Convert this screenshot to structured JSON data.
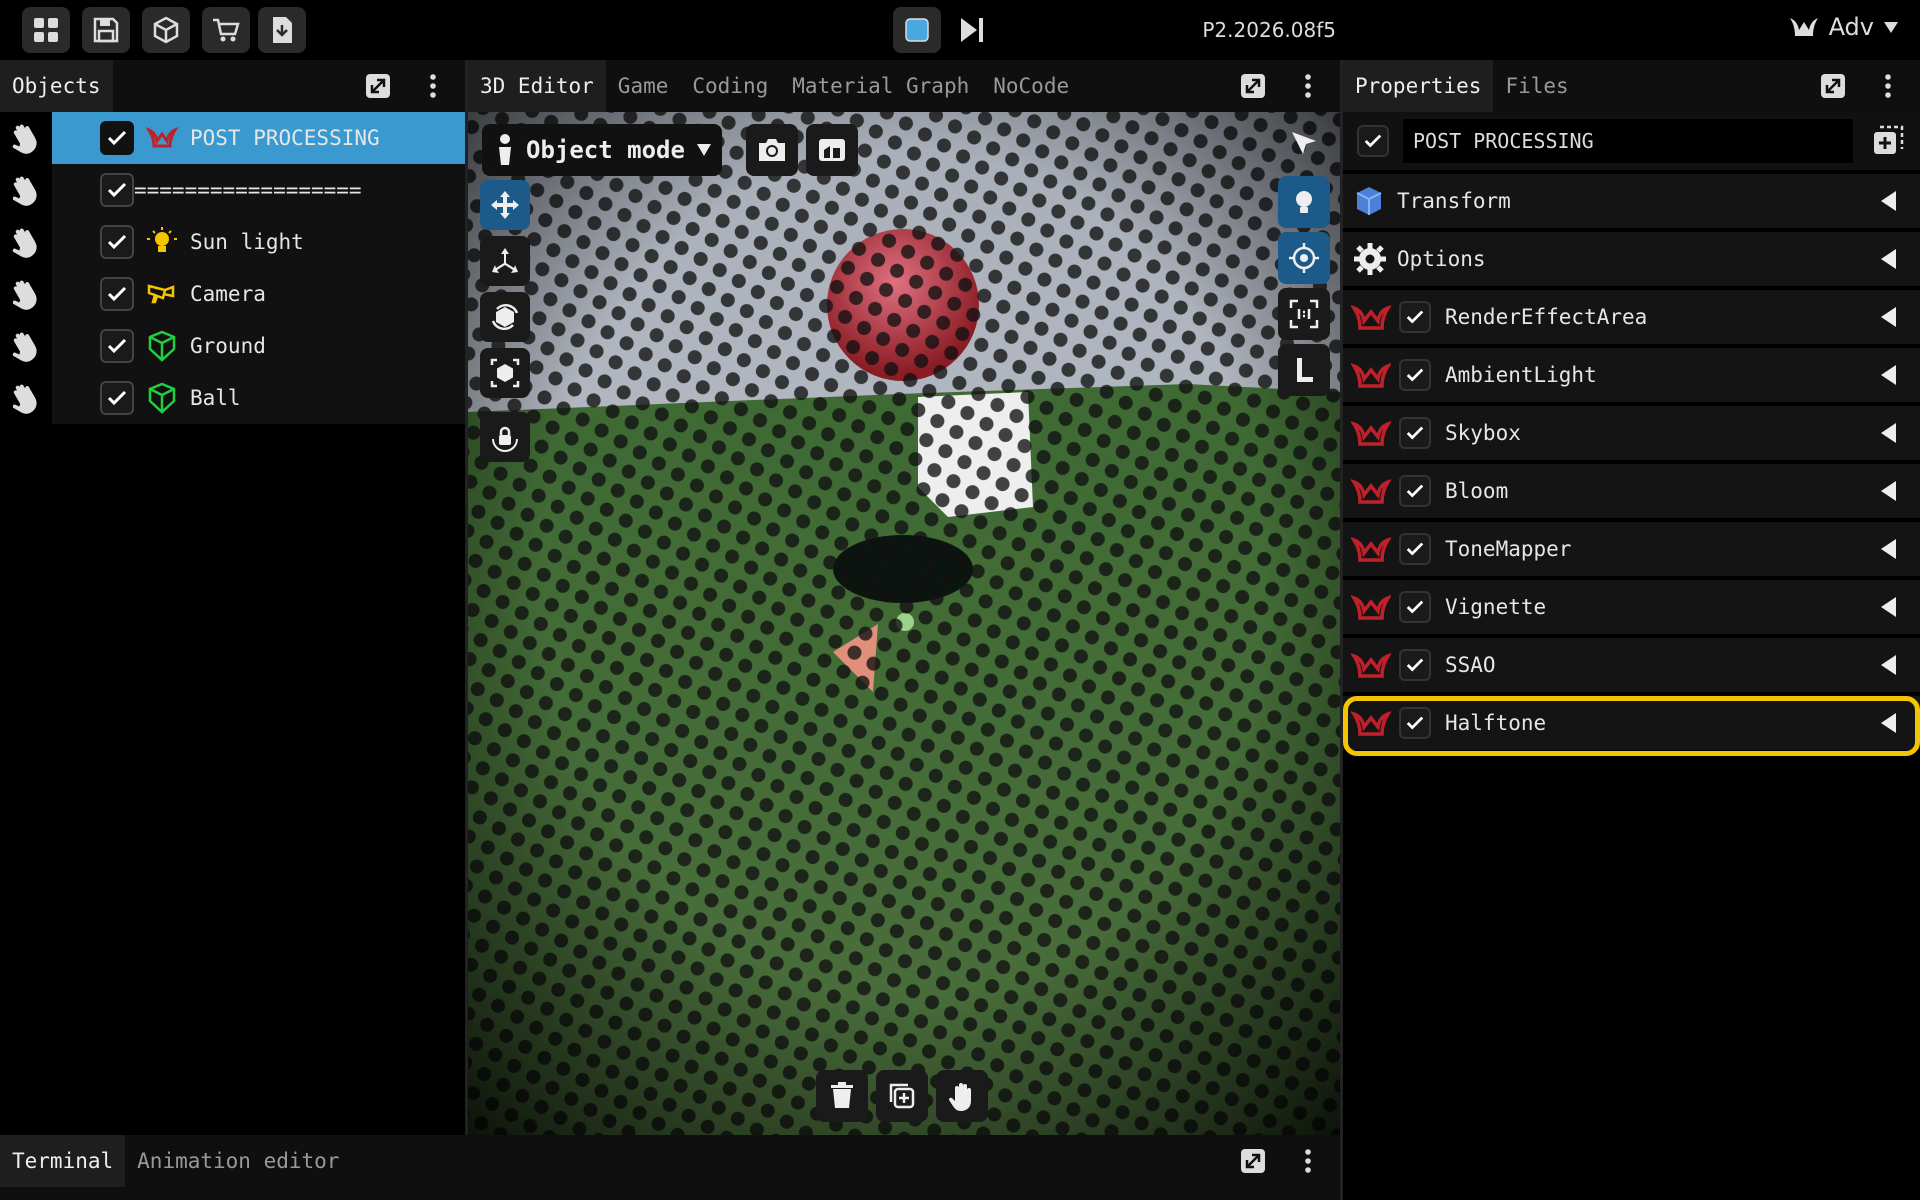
{
  "topbar": {
    "left_buttons": [
      "grid-icon",
      "save-icon",
      "cube-icon",
      "cart-icon",
      "download-file-icon"
    ],
    "play_controls": [
      "stop-icon",
      "step-forward-icon"
    ],
    "version": "P2.2026.08f5",
    "user_label": "Adv"
  },
  "objects_panel": {
    "tab": "Objects",
    "rows": [
      {
        "label": "POST PROCESSING",
        "icon": "post-processing-icon",
        "checked": true,
        "selected": true
      },
      {
        "label": "==================",
        "icon": "",
        "checked": true,
        "selected": false
      },
      {
        "label": "Sun light",
        "icon": "light-bulb-icon",
        "checked": true,
        "selected": false
      },
      {
        "label": "Camera",
        "icon": "camera-icon",
        "checked": true,
        "selected": false
      },
      {
        "label": "Ground",
        "icon": "mesh-icon",
        "checked": true,
        "selected": false
      },
      {
        "label": "Ball",
        "icon": "mesh-icon",
        "checked": true,
        "selected": false
      }
    ]
  },
  "editor": {
    "tabs": [
      "3D Editor",
      "Game",
      "Coding",
      "Material Graph",
      "NoCode"
    ],
    "active_tab": "3D Editor",
    "mode": "Object mode"
  },
  "properties_panel": {
    "tabs": [
      "Properties",
      "Files"
    ],
    "active_tab": "Properties",
    "object_name": "POST PROCESSING",
    "sections": [
      {
        "label": "Transform",
        "icon": "cube-icon"
      },
      {
        "label": "Options",
        "icon": "gear-icon"
      }
    ],
    "effects": [
      "RenderEffectArea",
      "AmbientLight",
      "Skybox",
      "Bloom",
      "ToneMapper",
      "Vignette",
      "SSAO",
      "Halftone"
    ],
    "highlighted_effect": "Halftone"
  },
  "bottom_panel": {
    "tabs": [
      "Terminal",
      "Animation editor"
    ],
    "active_tab": "Terminal"
  },
  "colors": {
    "selection": "#3a9ad0",
    "highlight": "#f5c400",
    "accent_red": "#c0202a",
    "mesh_green": "#20d040",
    "tool_blue": "#1c5a8a"
  }
}
